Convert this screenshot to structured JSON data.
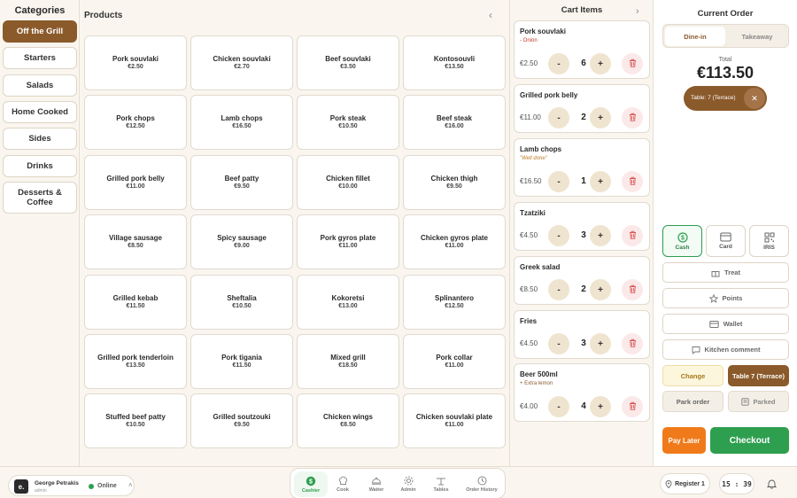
{
  "categories": {
    "title": "Categories",
    "items": [
      "Off the Grill",
      "Starters",
      "Salads",
      "Home Cooked",
      "Sides",
      "Drinks",
      "Desserts & Coffee"
    ],
    "active": "Off the Grill"
  },
  "products": {
    "title": "Products",
    "items": [
      {
        "name": "Pork souvlaki",
        "price": "€2.50"
      },
      {
        "name": "Chicken souvlaki",
        "price": "€2.70"
      },
      {
        "name": "Beef souvlaki",
        "price": "€3.50"
      },
      {
        "name": "Kontosouvli",
        "price": "€13.50"
      },
      {
        "name": "Pork chops",
        "price": "€12.50"
      },
      {
        "name": "Lamb chops",
        "price": "€16.50"
      },
      {
        "name": "Pork steak",
        "price": "€10.50"
      },
      {
        "name": "Beef steak",
        "price": "€16.00"
      },
      {
        "name": "Grilled pork belly",
        "price": "€11.00"
      },
      {
        "name": "Beef patty",
        "price": "€9.50"
      },
      {
        "name": "Chicken fillet",
        "price": "€10.00"
      },
      {
        "name": "Chicken thigh",
        "price": "€9.50"
      },
      {
        "name": "Village sausage",
        "price": "€8.50"
      },
      {
        "name": "Spicy sausage",
        "price": "€9.00"
      },
      {
        "name": "Pork gyros plate",
        "price": "€11.00"
      },
      {
        "name": "Chicken gyros plate",
        "price": "€11.00"
      },
      {
        "name": "Grilled kebab",
        "price": "€11.50"
      },
      {
        "name": "Sheftalia",
        "price": "€10.50"
      },
      {
        "name": "Kokoretsi",
        "price": "€13.00"
      },
      {
        "name": "Splinantero",
        "price": "€12.50"
      },
      {
        "name": "Grilled pork tenderloin",
        "price": "€13.50"
      },
      {
        "name": "Pork tigania",
        "price": "€11.50"
      },
      {
        "name": "Mixed grill",
        "price": "€18.50"
      },
      {
        "name": "Pork collar",
        "price": "€11.00"
      },
      {
        "name": "Stuffed beef patty",
        "price": "€10.50"
      },
      {
        "name": "Grilled soutzouki",
        "price": "€9.50"
      },
      {
        "name": "Chicken wings",
        "price": "€8.50"
      },
      {
        "name": "Chicken souvlaki plate",
        "price": "€11.00"
      }
    ]
  },
  "cart": {
    "title": "Cart Items",
    "items": [
      {
        "name": "Pork souvlaki",
        "note": "- Onion",
        "note_style": "red",
        "price": "€2.50",
        "qty": "6"
      },
      {
        "name": "Grilled pork belly",
        "note": "",
        "note_style": "",
        "price": "€11.00",
        "qty": "2"
      },
      {
        "name": "Lamb chops",
        "note": "\"Well done\"",
        "note_style": "italic",
        "price": "€16.50",
        "qty": "1"
      },
      {
        "name": "Tzatziki",
        "note": "",
        "note_style": "",
        "price": "€4.50",
        "qty": "3"
      },
      {
        "name": "Greek salad",
        "note": "",
        "note_style": "",
        "price": "€8.50",
        "qty": "2"
      },
      {
        "name": "Fries",
        "note": "",
        "note_style": "",
        "price": "€4.50",
        "qty": "3"
      },
      {
        "name": "Beer 500ml",
        "note": "+ Extra lemon",
        "note_style": "dark",
        "price": "€4.00",
        "qty": "4"
      }
    ],
    "minus_label": "-",
    "plus_label": "+"
  },
  "order": {
    "title": "Current Order",
    "dine_in": "Dine-in",
    "takeaway": "Takeaway",
    "total_label": "Total",
    "total_value": "€113.50",
    "table_label": "Table: 7 (Terrace)",
    "payment_methods": [
      {
        "label": "Cash",
        "icon": "cash-icon"
      },
      {
        "label": "Card",
        "icon": "card-icon"
      },
      {
        "label": "IRIS",
        "icon": "qr-icon"
      }
    ],
    "treat": "Treat",
    "points": "Points",
    "wallet": "Wallet",
    "kitchen_comment": "Kitchen comment",
    "change": "Change",
    "table_button": "Table 7 (Terrace)",
    "park_order": "Park order",
    "parked": "Parked",
    "pay_later": "Pay Later",
    "checkout": "Checkout"
  },
  "footer": {
    "user_initial": "e.",
    "user_name": "George Petrakis",
    "user_role": "admin",
    "status": "Online",
    "nav": [
      {
        "label": "Cashier",
        "icon": "cashier-icon"
      },
      {
        "label": "Cook",
        "icon": "cook-icon"
      },
      {
        "label": "Waiter",
        "icon": "waiter-icon"
      },
      {
        "label": "Admin",
        "icon": "admin-icon"
      },
      {
        "label": "Tables",
        "icon": "tables-icon"
      },
      {
        "label": "Order History",
        "icon": "history-icon"
      }
    ],
    "register": "Register 1",
    "clock": "15 : 39"
  },
  "colors": {
    "brand": "#8b5a2b",
    "success": "#2e9e4f",
    "orange": "#f07a1a",
    "background": "#faf6ef"
  }
}
